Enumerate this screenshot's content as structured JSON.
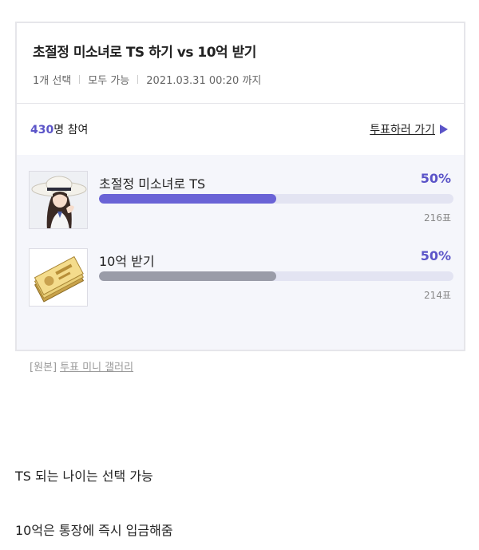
{
  "poll": {
    "title": "초절정 미소녀로 TS 하기 vs 10억 받기",
    "meta": {
      "selection": "1개 선택",
      "visibility": "모두 가능",
      "deadline": "2021.03.31 00:20 까지"
    },
    "participants": {
      "count": "430",
      "suffix": "명 참여"
    },
    "vote_link": "투표하러 가기",
    "options": [
      {
        "label": "초절정 미소녀로 TS",
        "percent": "50%",
        "votes": "216표",
        "fraction": 0.5,
        "thumb_icon": "anime-girl-with-hat-image"
      },
      {
        "label": "10억 받기",
        "percent": "50%",
        "votes": "214표",
        "fraction": 0.5,
        "thumb_icon": "korean-won-banknotes-image"
      }
    ]
  },
  "source": {
    "prefix": "[원본]",
    "link": "투표 미니 갤러리"
  },
  "body": {
    "line1": "TS 되는 나이는 선택 가능",
    "line2": "10억은 통장에 즉시 입금해줌"
  },
  "colors": {
    "accent": "#5b54c8",
    "leader_bar": "#6a63d6",
    "other_bar": "#9a9ca8",
    "track": "#e3e4f2"
  }
}
